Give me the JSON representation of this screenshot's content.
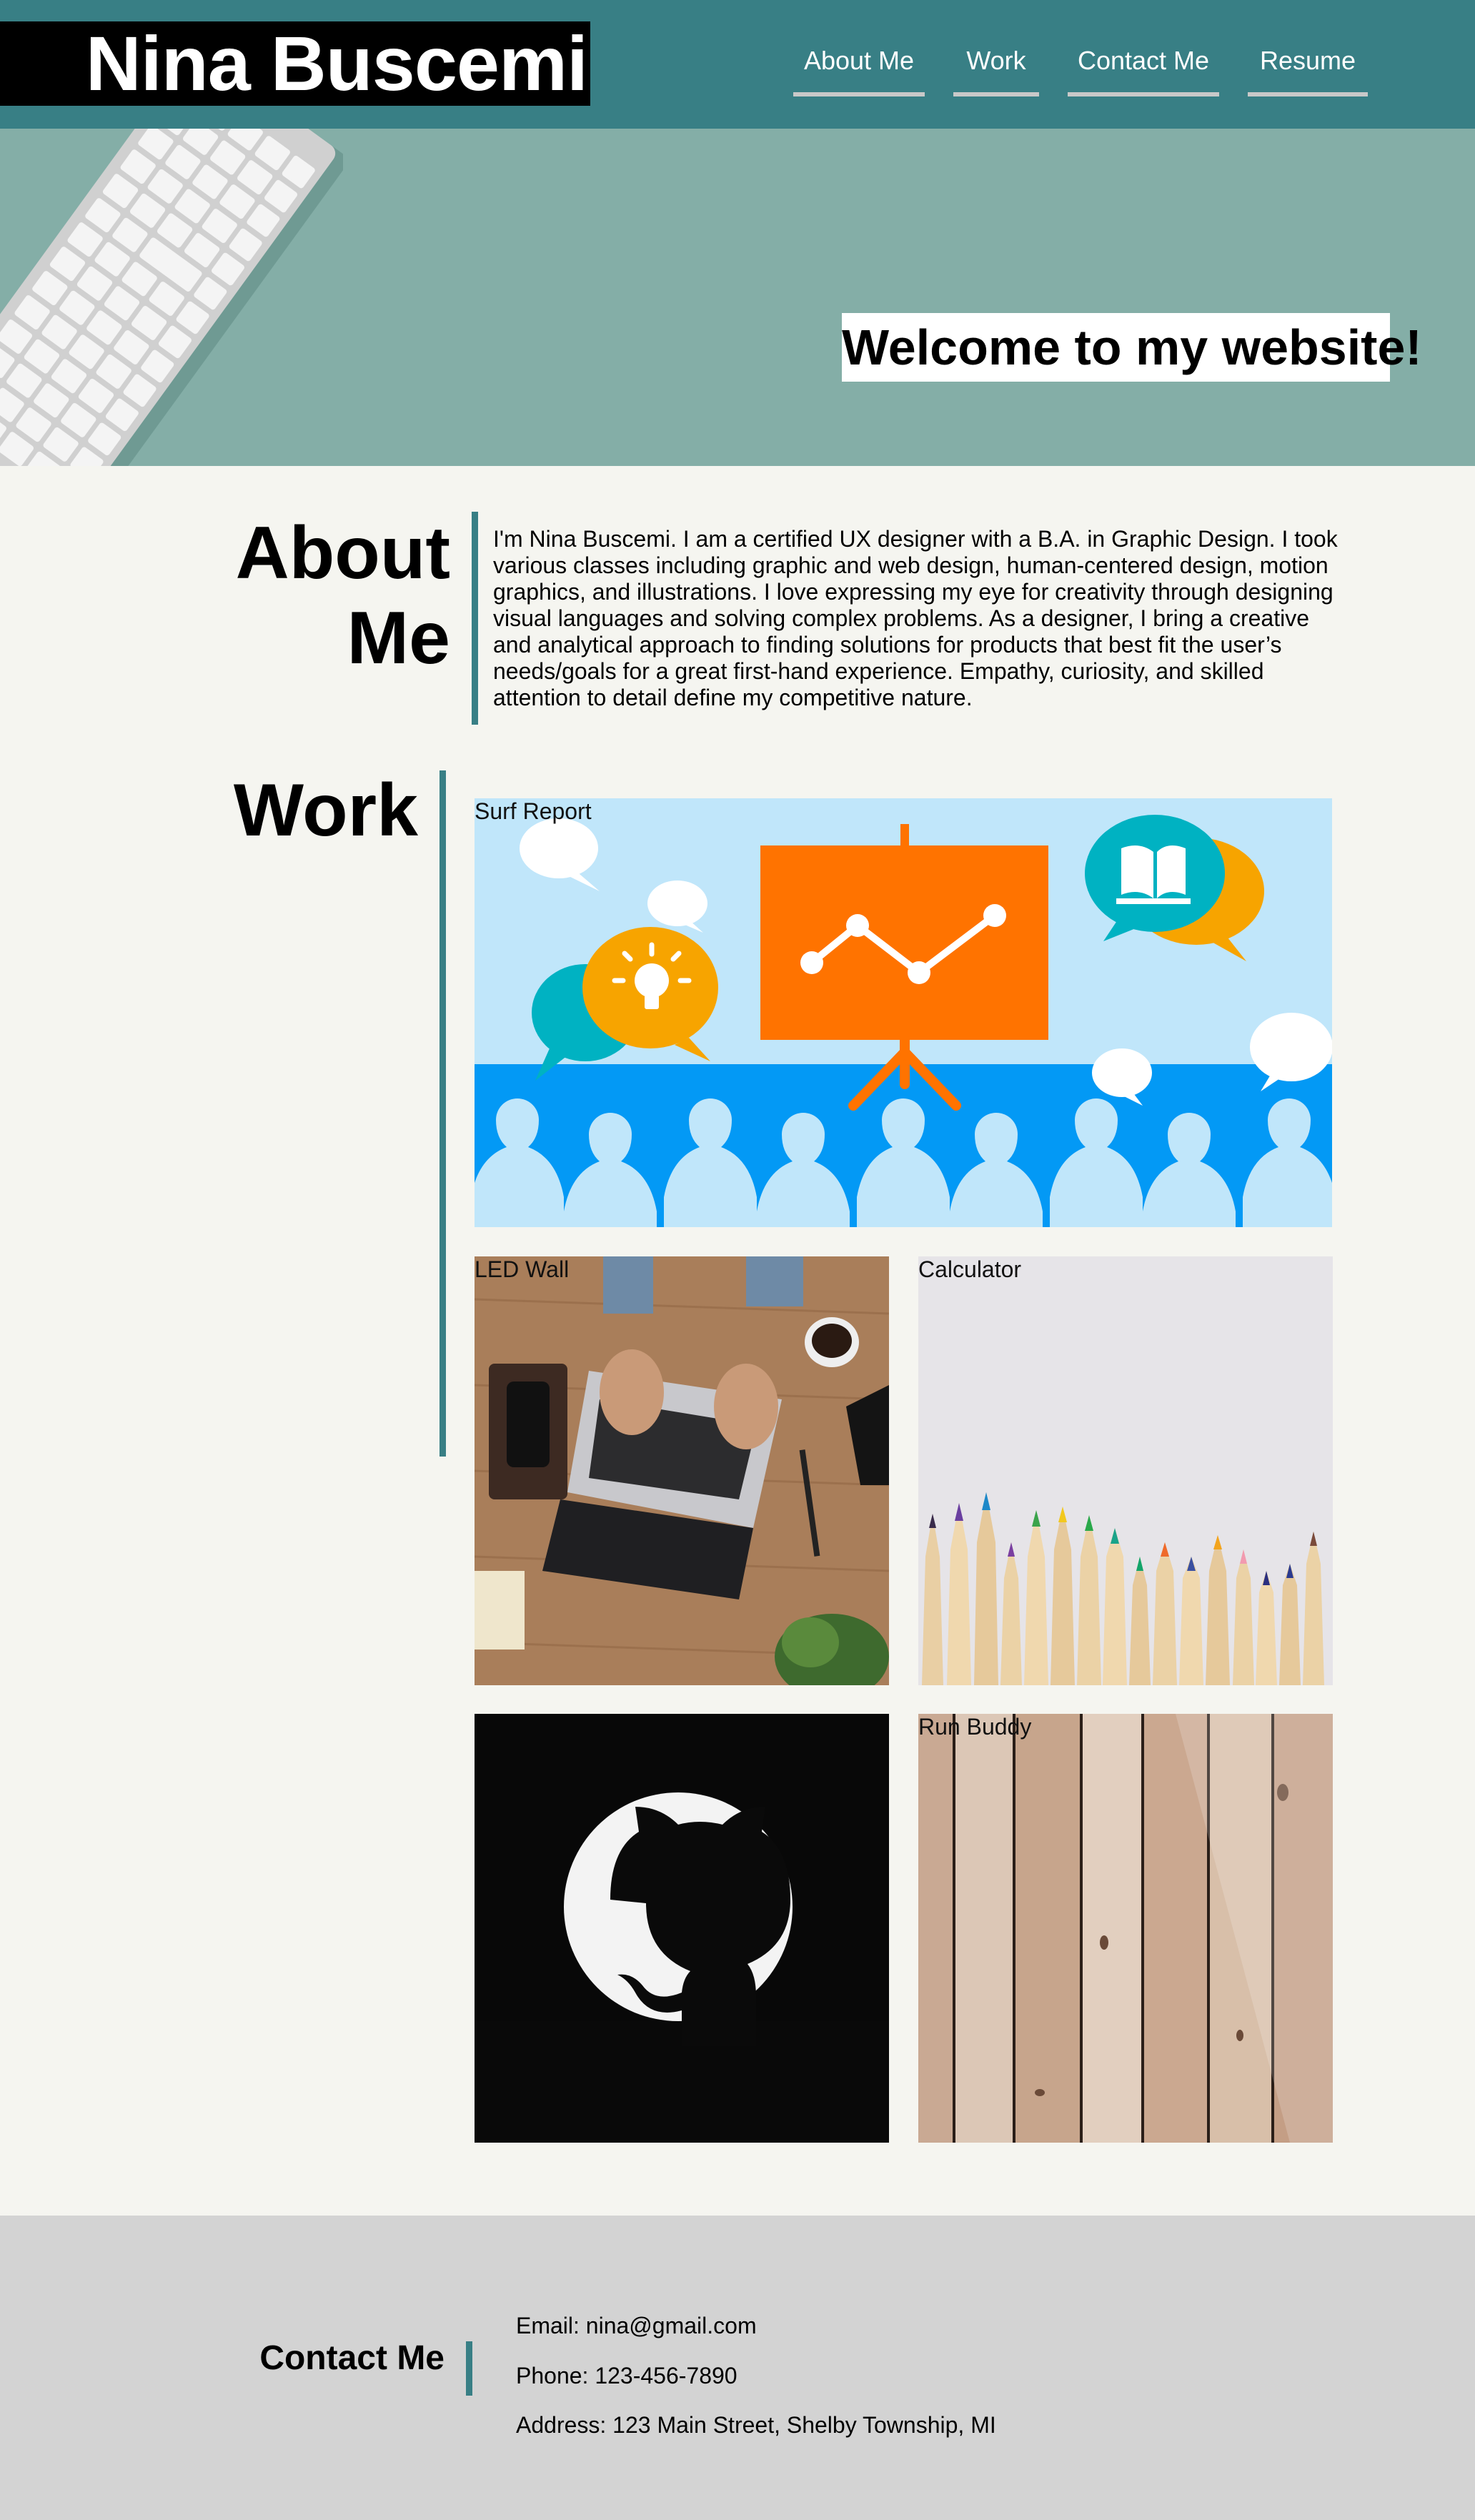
{
  "header": {
    "site_title": "Nina Buscemi",
    "nav": [
      "About Me",
      "Work",
      "Contact Me",
      "Resume"
    ]
  },
  "hero": {
    "welcome": "Welcome to my website!"
  },
  "about": {
    "title": "About Me",
    "text": "I'm Nina Buscemi. I am a certified UX designer with a B.A. in Graphic Design. I took various classes including graphic and web design, human-centered design, motion graphics, and illustrations. I love expressing my eye for creativity through designing visual languages and solving complex problems. As a designer, I bring a creative and analytical approach to finding solutions for products that best fit the user’s needs/goals for a great first-hand experience. Empathy, curiosity, and skilled attention to detail define my competitive nature."
  },
  "work": {
    "title": "Work",
    "projects": [
      {
        "label": "Surf Report",
        "image": "presentation-illustration"
      },
      {
        "label": "LED Wall",
        "image": "laptop-desk-photo"
      },
      {
        "label": "Calculator",
        "image": "colored-pencils-photo"
      },
      {
        "label": "",
        "image": "github-logo"
      },
      {
        "label": "Run Buddy",
        "image": "wood-planks-photo"
      }
    ]
  },
  "contact": {
    "title": "Contact Me",
    "email": "Email: nina@gmail.com",
    "phone": "Phone: 123-456-7890",
    "address": "Address: 123 Main Street, Shelby Township, MI"
  },
  "colors": {
    "header": "#387f85",
    "hero": "#84aea7",
    "accent_bar": "#387f85",
    "page_bg": "#f5f5f0",
    "footer": "#d3d3d3"
  }
}
